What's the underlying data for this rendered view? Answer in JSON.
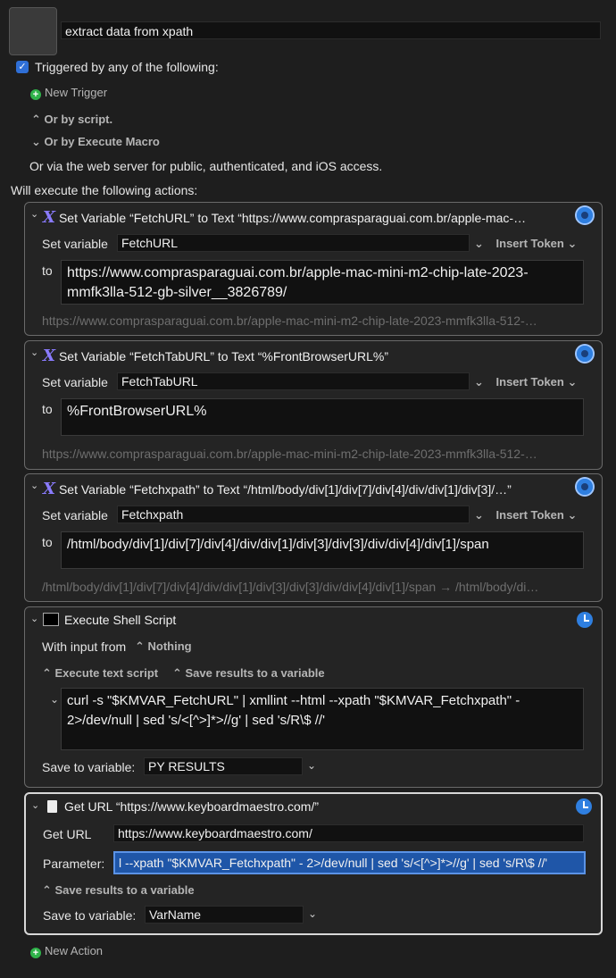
{
  "macro": {
    "name": "extract data from xpath",
    "triggered_label": "Triggered by any of the following:",
    "new_trigger": "New Trigger",
    "or_by_script": "Or by script.",
    "or_by_execute_macro": "Or by Execute Macro",
    "web_server_note": "Or via the web server for public, authenticated, and iOS access.",
    "will_execute": "Will execute the following actions:",
    "new_action": "New Action"
  },
  "actions": [
    {
      "title": "Set Variable “FetchURL” to Text “https://www.comprasparaguai.com.br/apple-mac-…",
      "set_variable_label": "Set variable",
      "variable": "FetchURL",
      "insert_token": "Insert Token",
      "to_label": "to",
      "text": "https://www.comprasparaguai.com.br/apple-mac-mini-m2-chip-late-2023-mmfk3lla-512-gb-silver__3826789/",
      "preview": "https://www.comprasparaguai.com.br/apple-mac-mini-m2-chip-late-2023-mmfk3lla-512-…"
    },
    {
      "title": "Set Variable “FetchTabURL” to Text “%FrontBrowserURL%”",
      "set_variable_label": "Set variable",
      "variable": "FetchTabURL",
      "insert_token": "Insert Token",
      "to_label": "to",
      "text": "%FrontBrowserURL%",
      "preview": "https://www.comprasparaguai.com.br/apple-mac-mini-m2-chip-late-2023-mmfk3lla-512-…"
    },
    {
      "title": "Set Variable “Fetchxpath” to Text “/html/body/div[1]/div[7]/div[4]/div/div[1]/div[3]/…”",
      "set_variable_label": "Set variable",
      "variable": "Fetchxpath",
      "insert_token": "Insert Token",
      "to_label": "to",
      "text": "/html/body/div[1]/div[7]/div[4]/div/div[1]/div[3]/div[3]/div/div[4]/div[1]/span",
      "preview": "/html/body/div[1]/div[7]/div[4]/div/div[1]/div[3]/div[3]/div/div[4]/div[1]/span → /html/body/di…"
    }
  ],
  "shell": {
    "title": "Execute Shell Script",
    "with_input_label": "With input from",
    "with_input_value": "Nothing",
    "execute_mode": "Execute text script",
    "results_mode": "Save results to a variable",
    "script": "curl -s \"$KMVAR_FetchURL\" | xmllint --html --xpath \"$KMVAR_Fetchxpath\" - 2>/dev/null | sed 's/<[^>]*>//g' | sed 's/R\\$ //'",
    "save_label": "Save to variable:",
    "save_value": "PY RESULTS"
  },
  "geturl": {
    "title": "Get URL “https://www.keyboardmaestro.com/”",
    "url_label": "Get URL",
    "url_value": "https://www.keyboardmaestro.com/",
    "param_label": "Parameter:",
    "param_value": "l --xpath \"$KMVAR_Fetchxpath\" - 2>/dev/null | sed 's/<[^>]*>//g' | sed 's/R\\$ //'",
    "results_mode": "Save results to a variable",
    "save_label": "Save to variable:",
    "save_value": "VarName"
  },
  "colors": {
    "accent": "#2f7fe0",
    "trigger_green": "#2fb34a",
    "variable_icon": "#8a7bff"
  }
}
